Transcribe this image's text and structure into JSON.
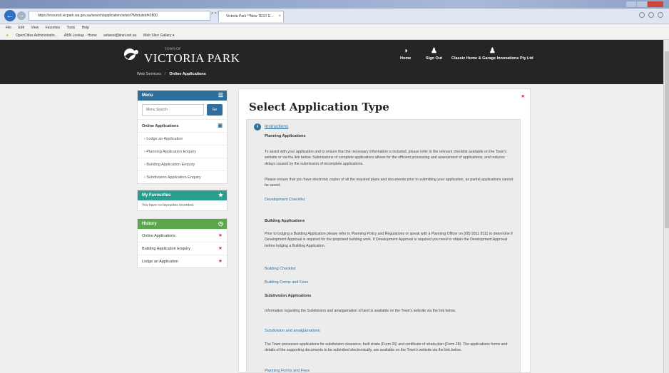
{
  "browser": {
    "url": "https://ecouncil.vicpark.wa.gov.au/search/application/select?ModuleId=2800",
    "url_controls": "⌕ ▾ ▣ ↻",
    "tab_title": "Victoria Park **New TEST E...",
    "tab_close": "×",
    "menu": [
      "File",
      "Edit",
      "View",
      "Favorites",
      "Tools",
      "Help"
    ],
    "favorites": [
      "OpenCities Administratio...",
      "ABN Lookup - Home",
      "selwest@iinet.net.au",
      "Web Slice Gallery ▾"
    ]
  },
  "site": {
    "logo_small": "TOWN OF",
    "logo_text": "VICTORIA PARK",
    "breadcrumb": {
      "root": "Web Services",
      "sep": "/",
      "current": "Online Applications"
    },
    "nav": [
      {
        "icon": "◑",
        "label": "Home"
      },
      {
        "icon": "♟",
        "label": "Sign Out"
      },
      {
        "icon": "♟",
        "label": "Classic Home & Garage Innovations Pty Ltd"
      }
    ]
  },
  "sidebar": {
    "menu": {
      "title": "Menu",
      "icon": "☰",
      "search_placeholder": "Menu Search",
      "go_label": "Go",
      "section": "Online Applications",
      "section_icon": "▣",
      "items": [
        "Lodge an Application",
        "Planning Application Enquiry",
        "Building Application Enquiry",
        "Subdivision Application Enquiry"
      ]
    },
    "favourites": {
      "title": "My Favourites",
      "icon": "★",
      "empty_text": "You have no favourites recorded."
    },
    "history": {
      "title": "History",
      "icon": "◷",
      "item_icon": "★",
      "items": [
        "Online Applications",
        "Building Application Enquiry",
        "Lodge an Application"
      ]
    }
  },
  "main": {
    "title": "Select Application Type",
    "corner_star": "★",
    "info_icon": "i",
    "instructions_label": "Instructions",
    "planning_heading": "Planning Applications",
    "planning_text_1": "To assist with your application and to ensure that the necessary information is included, please refer to the relevant checklist available on the Town's website or via the link below. Submissions of complete applications allows for the efficient processing and assessment of applications, and reduces delays caused by the submission of incomplete applications.",
    "planning_text_2": "Please ensure that you have electronic copies of all the required plans and documents prior to submitting your application, as partial applications cannot be saved.",
    "planning_link": "Development Checklist",
    "building_heading": "Building Applications",
    "building_text": "Prior to lodging a Building Application please refer to Planning Policy and Regulations or speak with a Planning Officer on (08) 9311 8111 to determine if Development Approval is required for the proposed building work. If Development Approval is required you need to obtain the Development Approval before lodging a Building Application.",
    "building_link_1": "Building Checklist",
    "building_link_2": "Building Forms and Fees",
    "subdivision_heading": "Subdivision Applications",
    "subdivision_text_1": "Information regarding the Subdivision and amalgamation of land is available on the Town's website via the link below.",
    "subdivision_link": "Subdivision and amalgamations",
    "subdivision_text_2": "The Town processes applications for subdivision clearance, built strata (Form 26) and certificate of strata plan (Form 28). The applications forms and details of the supporting documents to be submitted electronically, are available on the Town's website via the link below.",
    "subdivision_link_2": "Planning Forms and Fees"
  },
  "colors": {
    "header_bg": "#252525",
    "menu_blue": "#2e6f9e",
    "favourites_teal": "#2a9d8f",
    "history_green": "#5aa84a",
    "link_blue": "#2e6f9e",
    "accent_pink": "#d22f8a"
  }
}
